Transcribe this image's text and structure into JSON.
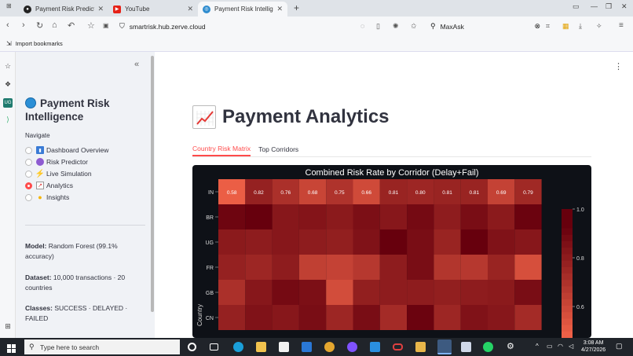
{
  "browser": {
    "tabs": [
      {
        "title": "Payment Risk Prediction",
        "active": false
      },
      {
        "title": "YouTube",
        "active": false
      },
      {
        "title": "Payment Risk Intelligenc",
        "active": true
      }
    ],
    "url": "smartrisk.hub.zerve.cloud",
    "search_value": "MaxAsk",
    "bookmark": "Import bookmarks"
  },
  "sidebar": {
    "title": "Payment Risk Intelligence",
    "nav_label": "Navigate",
    "items": [
      {
        "label": "Dashboard Overview",
        "selected": false,
        "icon": "bar-chart-icon"
      },
      {
        "label": "Risk Predictor",
        "selected": false,
        "icon": "crystal-ball-icon"
      },
      {
        "label": "Live Simulation",
        "selected": false,
        "icon": "lightning-icon"
      },
      {
        "label": "Analytics",
        "selected": true,
        "icon": "chart-up-icon"
      },
      {
        "label": "Insights",
        "selected": false,
        "icon": "lightbulb-icon"
      }
    ],
    "model_key": "Model:",
    "model_value": "Random Forest (99.1% accuracy)",
    "dataset_key": "Dataset:",
    "dataset_value": "10,000 transactions · 20 countries",
    "classes_key": "Classes:",
    "classes_value": "SUCCESS · DELAYED · FAILED"
  },
  "main": {
    "title": "Payment Analytics",
    "tabs": [
      {
        "label": "Country Risk Matrix",
        "active": true
      },
      {
        "label": "Top Corridors",
        "active": false
      }
    ]
  },
  "chart_data": {
    "type": "heatmap",
    "title": "Combined Risk Rate by Corridor (Delay+Fail)",
    "rows": [
      "IN",
      "BR",
      "UG",
      "FR",
      "GB",
      "CN"
    ],
    "ylabel": "Country",
    "first_row_values": [
      0.58,
      0.82,
      0.76,
      0.68,
      0.75,
      0.66,
      0.81,
      0.8,
      0.81,
      0.81,
      0.69,
      0.79
    ],
    "colorbar_ticks": [
      "1.0",
      "0.8",
      "0.6"
    ],
    "colors": {
      "low": "#f6664a",
      "high": "#67000d"
    }
  },
  "taskbar": {
    "search_placeholder": "Type here to search",
    "time": "3:08 AM",
    "date": "4/27/2026"
  }
}
